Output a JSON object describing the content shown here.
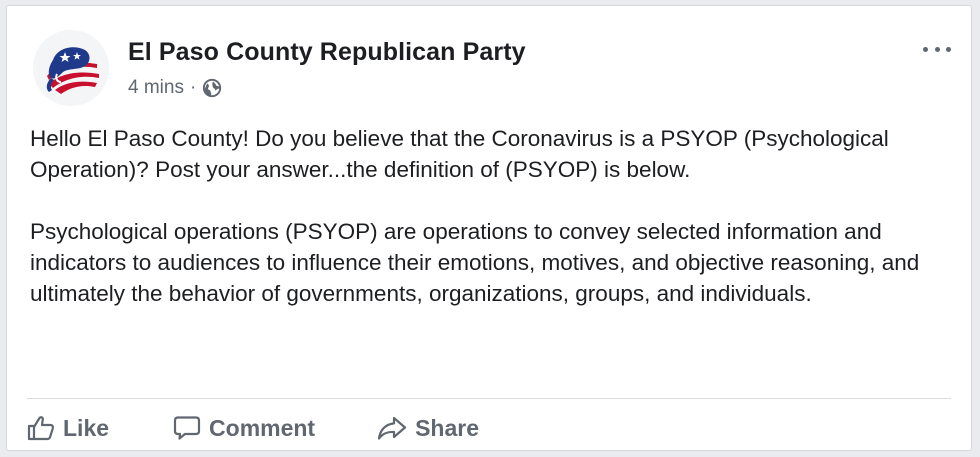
{
  "post": {
    "page_name": "El Paso County Republican Party",
    "timestamp": "4 mins",
    "separator": "·",
    "audience_icon": "globe-icon",
    "avatar_icon": "gop-elephant-logo",
    "paragraphs": [
      "Hello El Paso County!  Do you believe that the Coronavirus is a PSYOP (Psychological Operation)?  Post your answer...the definition of (PSYOP) is below.",
      "Psychological operations (PSYOP) are operations to convey selected information and indicators to audiences to influence their emotions, motives, and objective reasoning, and ultimately the behavior of governments, organizations, groups, and individuals."
    ]
  },
  "actions": {
    "like_label": "Like",
    "comment_label": "Comment",
    "share_label": "Share"
  },
  "colors": {
    "text": "#1c1e21",
    "secondary": "#616770",
    "action": "#606770",
    "logo_red": "#c8102e",
    "logo_blue": "#1f3a8a"
  }
}
